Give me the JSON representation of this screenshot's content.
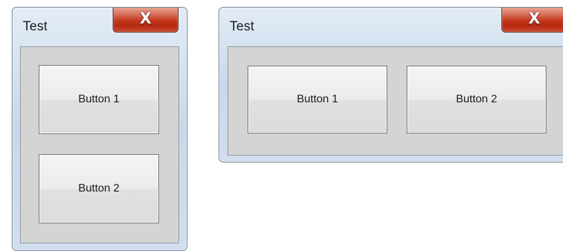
{
  "windows": [
    {
      "title": "Test",
      "close_glyph": "X",
      "buttons": [
        "Button 1",
        "Button 2"
      ],
      "layout": "vertical"
    },
    {
      "title": "Test",
      "close_glyph": "X",
      "buttons": [
        "Button 1",
        "Button 2"
      ],
      "layout": "horizontal"
    }
  ],
  "icons": {
    "close": "close-icon"
  },
  "colors": {
    "frame": "#c8d8ea",
    "client": "#d4d4d4",
    "close_button": "#c3371c",
    "button_face": "#ececec"
  }
}
